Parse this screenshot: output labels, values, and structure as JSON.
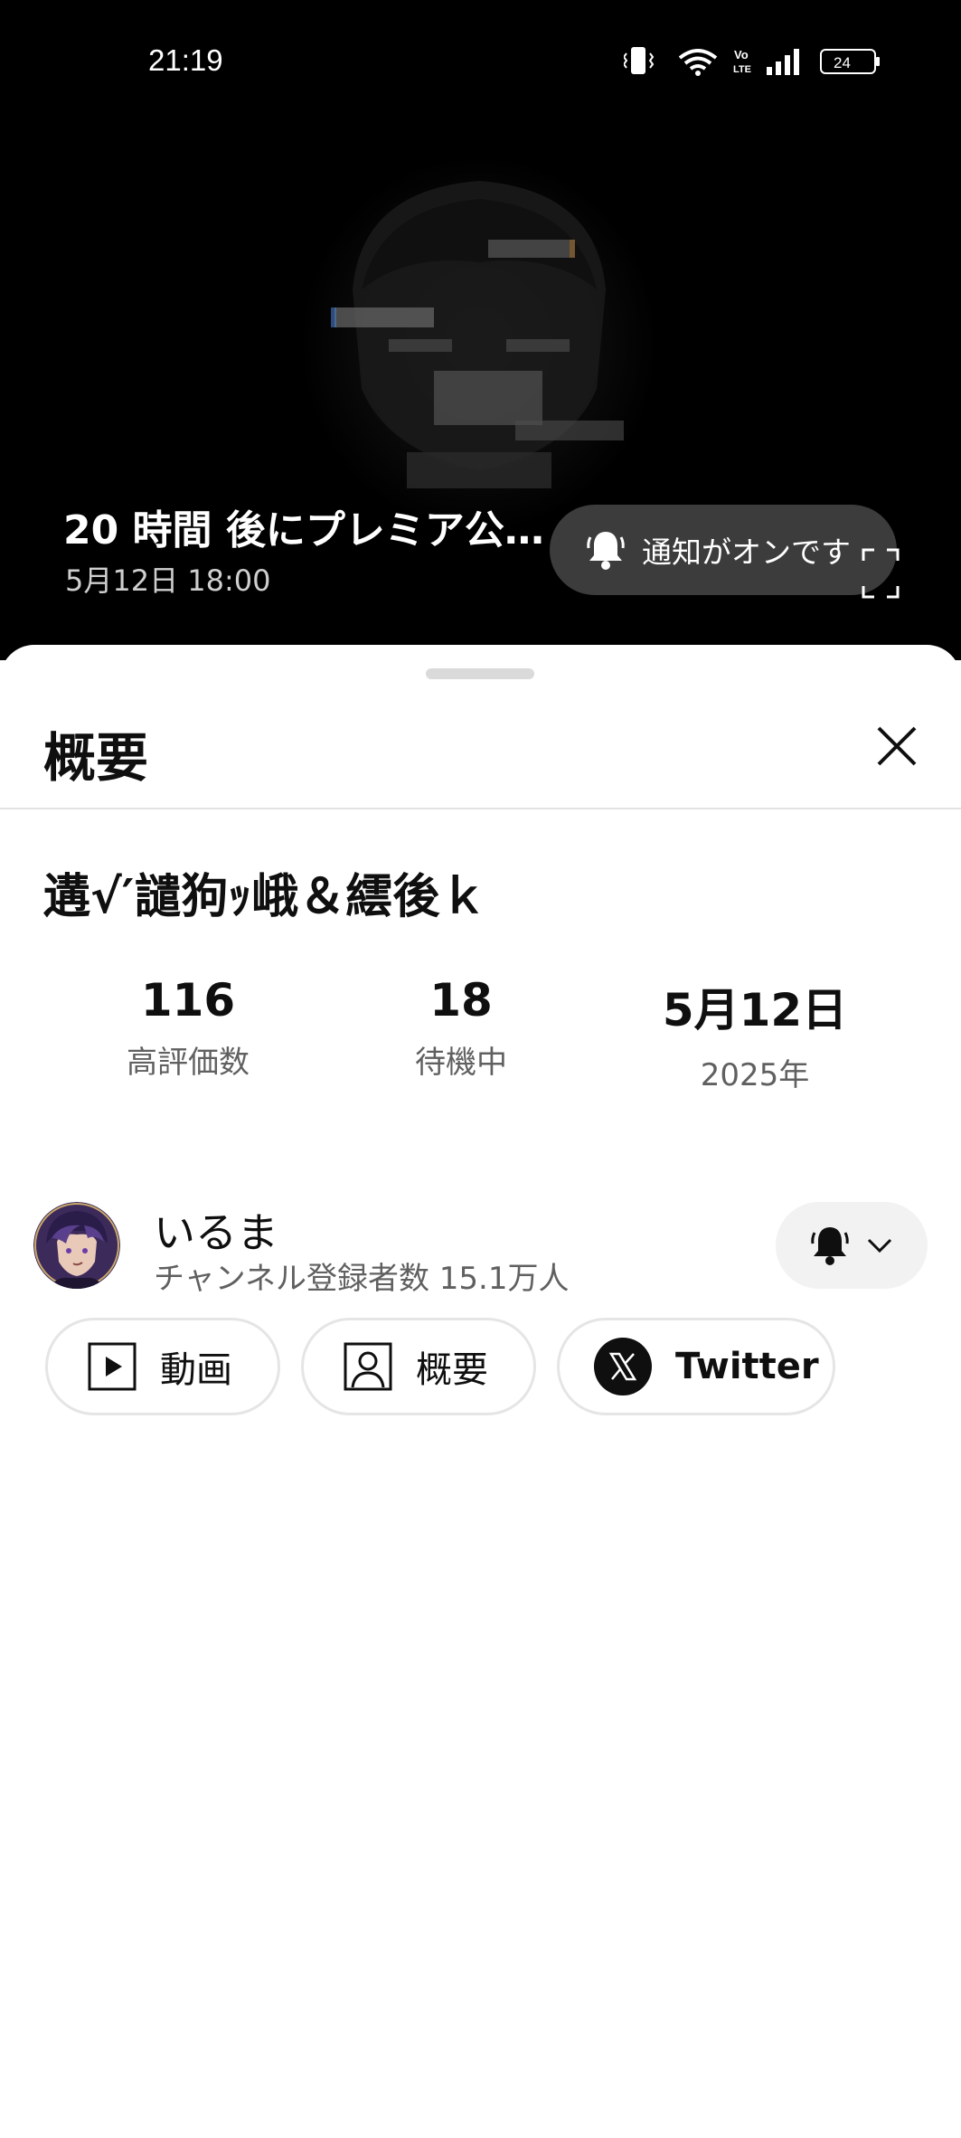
{
  "status_bar": {
    "time": "21:19",
    "battery": "24",
    "icons": [
      "vibrate-icon",
      "wifi-icon",
      "volte-icon",
      "signal-icon",
      "battery-icon"
    ]
  },
  "player": {
    "premiere_title": "20 時間 後にプレミア公…",
    "premiere_datetime": "5月12日 18:00",
    "notify_label": "通知がオンです",
    "icons": [
      "bell-icon",
      "fullscreen-icon"
    ]
  },
  "sheet": {
    "title": "概要",
    "video_title": "遘√′譴狗ｯ峨＆繧後ｋ",
    "stats": [
      {
        "value": "116",
        "label": "高評価数"
      },
      {
        "value": "18",
        "label": "待機中"
      },
      {
        "value": "5月12日",
        "label": "2025年"
      }
    ],
    "channel": {
      "name": "いるま",
      "subscribers": "チャンネル登録者数 15.1万人"
    },
    "chips": [
      {
        "label": "動画",
        "icon": "play-icon"
      },
      {
        "label": "概要",
        "icon": "person-icon"
      },
      {
        "label": "Twitter",
        "icon": "x-logo-icon"
      }
    ]
  },
  "colors": {
    "text_primary": "#0f0f0f",
    "text_secondary": "#606060",
    "chip_border": "#e5e5e5",
    "pill_bg": "#464646",
    "bell_button_bg": "#f2f2f2"
  }
}
